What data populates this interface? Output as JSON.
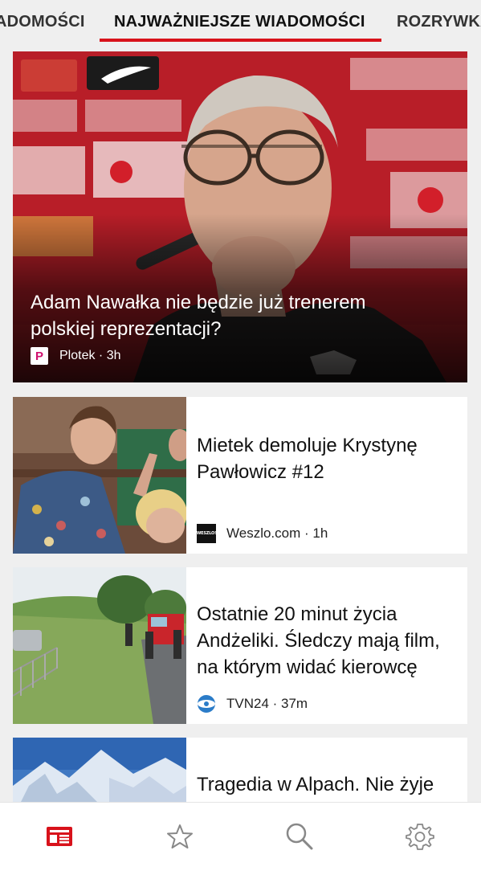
{
  "tabs": {
    "left": "ADOMOŚCI",
    "active": "NAJWAŻNIEJSZE WIADOMOŚCI",
    "right": "ROZRYWKA"
  },
  "hero": {
    "title": "Adam Nawałka nie będzie już trenerem polskiej reprezentacji?",
    "source": "Plotek · 3h",
    "source_logo_letter": "P"
  },
  "articles": [
    {
      "title": "Mietek demoluje Krystynę Pawłowicz #12",
      "source": "Weszlo.com · 1h",
      "source_logo_text": "WESZLO!"
    },
    {
      "title": "Ostatnie 20 minut życia Andżeliki. Śledczy mają film, na którym widać kierowcę",
      "source": "TVN24 · 37m"
    },
    {
      "title": "Tragedia w Alpach. Nie żyje",
      "source": ""
    }
  ],
  "bottom_nav": {
    "items": [
      "news-icon",
      "star-icon",
      "search-icon",
      "gear-icon"
    ],
    "active_index": 0
  },
  "colors": {
    "accent": "#d8121b",
    "inactive_icon": "#888888"
  }
}
